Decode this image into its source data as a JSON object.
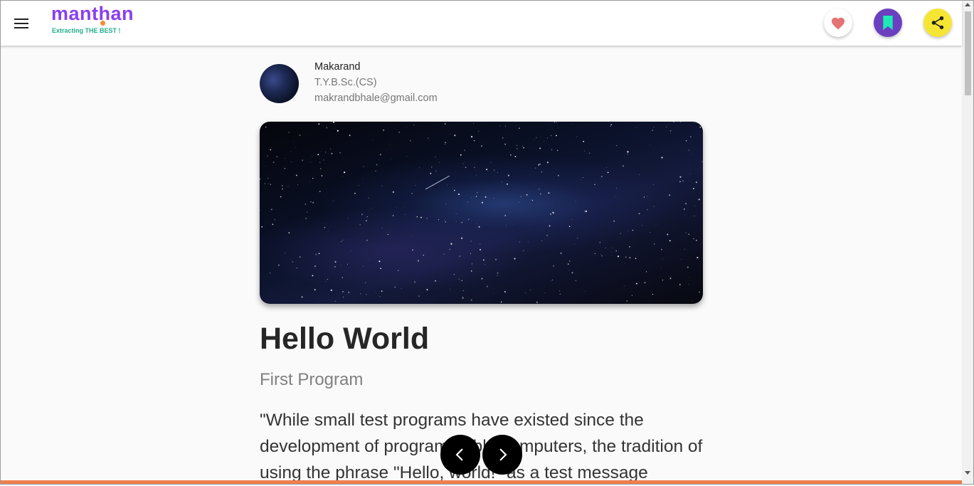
{
  "header": {
    "menu_icon": "hamburger-menu-icon",
    "logo": {
      "name": "manthan",
      "tagline": "Extracting THE BEST !",
      "color": "#8a3ef0",
      "tagline_color": "#1fae89"
    },
    "actions": [
      {
        "name": "like-button",
        "icon": "heart-icon",
        "color": "#e57373",
        "bg": "#ffffff"
      },
      {
        "name": "bookmark-button",
        "icon": "bookmark-icon",
        "color": "#1de9b6",
        "bg": "#6a3fc0"
      },
      {
        "name": "share-button",
        "icon": "share-icon",
        "color": "#222222",
        "bg": "#f6e634"
      }
    ]
  },
  "author": {
    "name": "Makarand",
    "class": "T.Y.B.Sc.(CS)",
    "email": "makrandbhale@gmail.com"
  },
  "post": {
    "title": "Hello World",
    "subtitle": "First Program",
    "body": "\"While small test programs have existed since the development of programmable computers, the tradition of using the phrase \"Hello, world!\" as a test message"
  },
  "navigation": {
    "prev_icon": "chevron-left-icon",
    "next_icon": "chevron-right-icon"
  },
  "colors": {
    "progress": "#ee7f4f",
    "background": "#fafafa"
  }
}
